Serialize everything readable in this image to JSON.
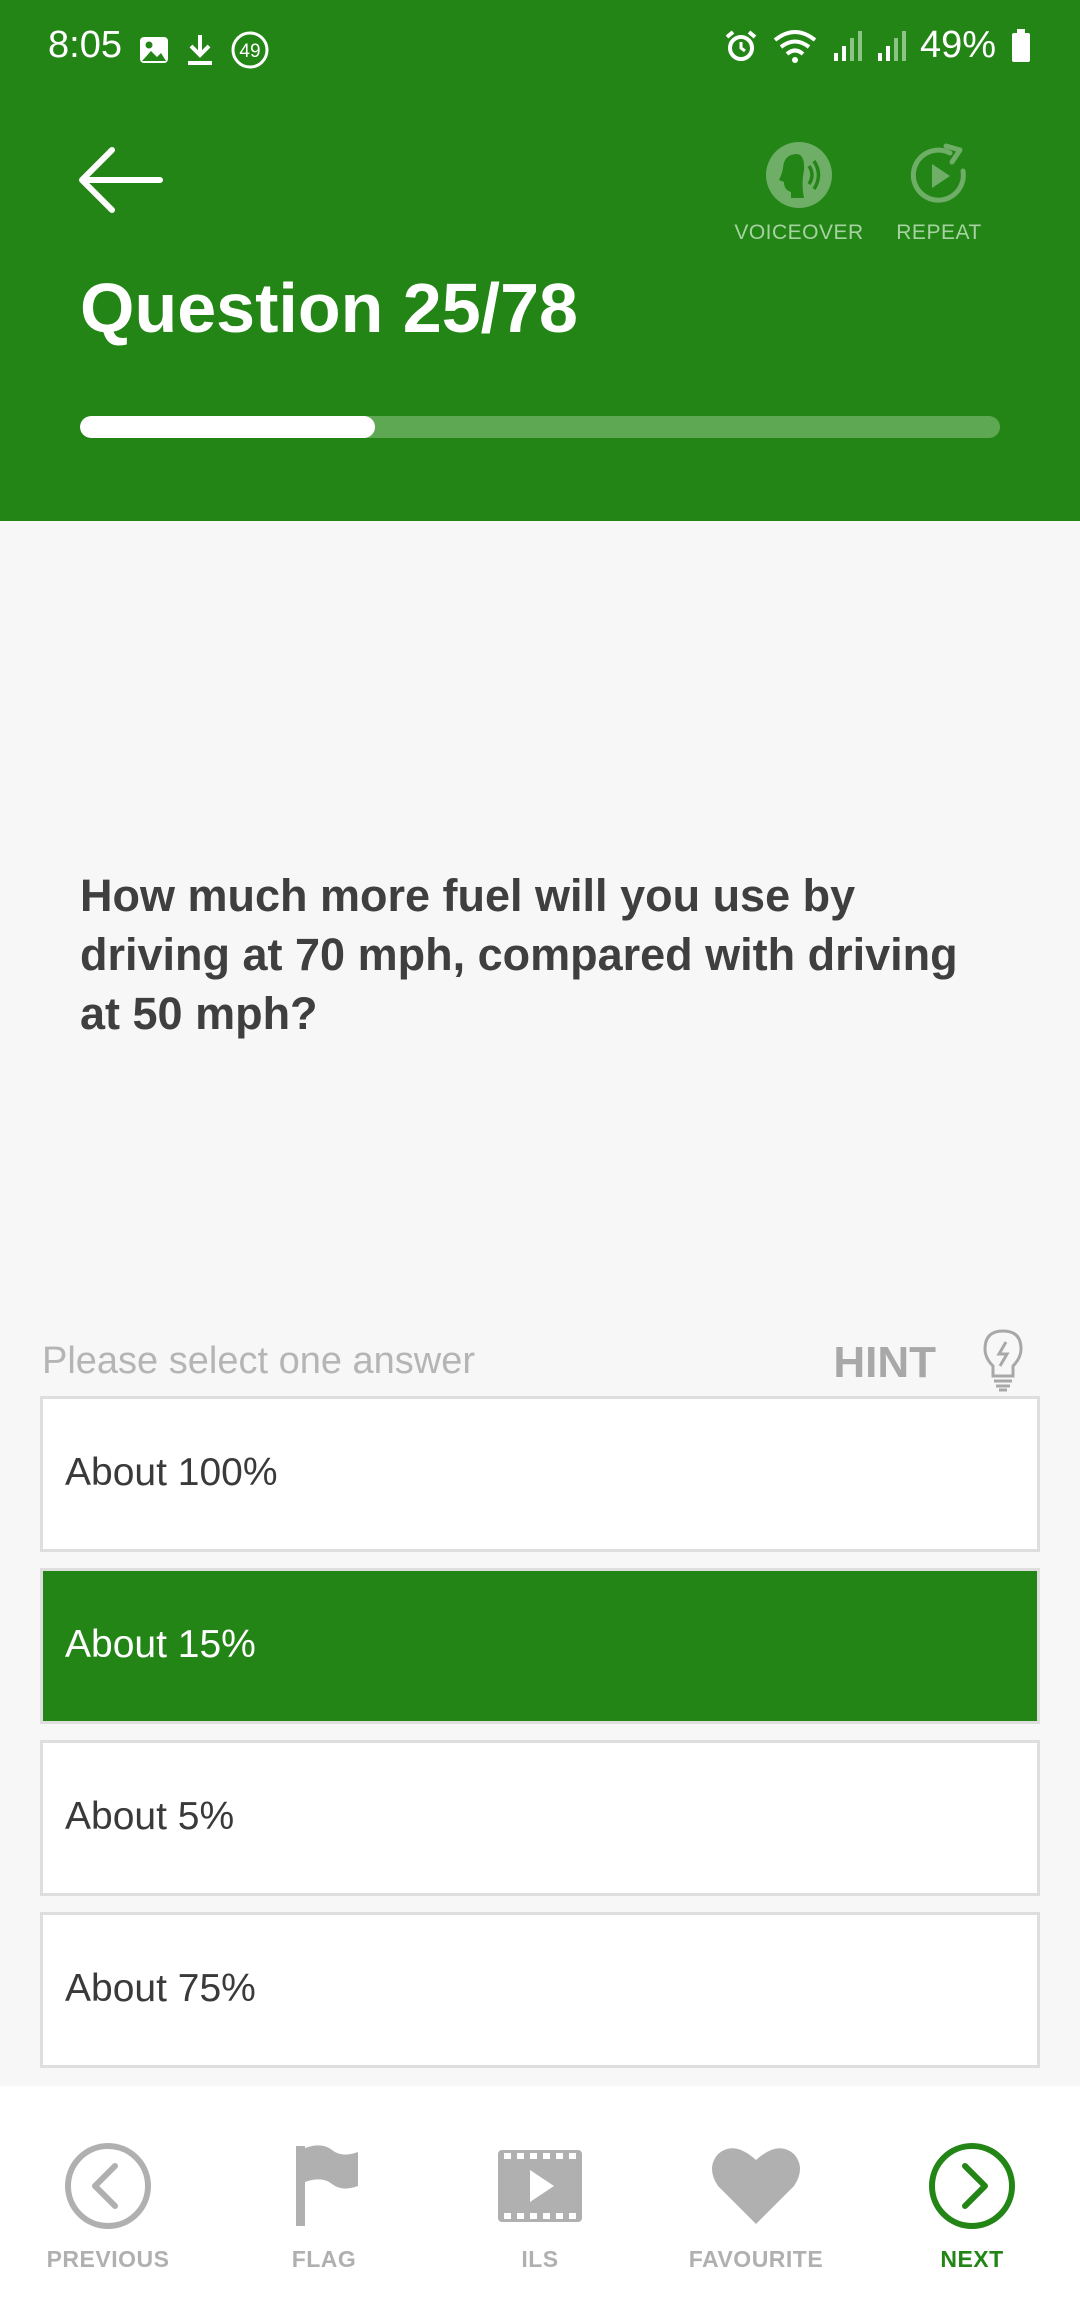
{
  "status_bar": {
    "time": "8:05",
    "notification_count": "49",
    "battery_percent": "49%",
    "left_icons": [
      "image-icon",
      "download-icon",
      "notification-count-icon"
    ],
    "right_icons": [
      "alarm-icon",
      "wifi-icon",
      "signal-icon",
      "signal-icon",
      "battery-icon"
    ]
  },
  "header": {
    "title": "Question 25/78",
    "voiceover_label": "VOICEOVER",
    "repeat_label": "REPEAT",
    "progress_fraction": 0.3205,
    "background_color": "#228515"
  },
  "question": {
    "text": "How much more fuel will you use by driving at 70 mph, compared with driving at 50 mph?"
  },
  "answers_section": {
    "prompt": "Please select one answer",
    "hint_label": "HINT",
    "options": [
      {
        "label": "About 100%",
        "selected": false
      },
      {
        "label": "About 15%",
        "selected": true
      },
      {
        "label": "About 5%",
        "selected": false
      },
      {
        "label": "About 75%",
        "selected": false
      }
    ]
  },
  "bottom_nav": {
    "previous_label": "PREVIOUS",
    "flag_label": "FLAG",
    "ils_label": "ILS",
    "favourite_label": "FAVOURITE",
    "next_label": "NEXT"
  },
  "colors": {
    "accent": "#228515",
    "inactive": "#b0b0b0"
  }
}
